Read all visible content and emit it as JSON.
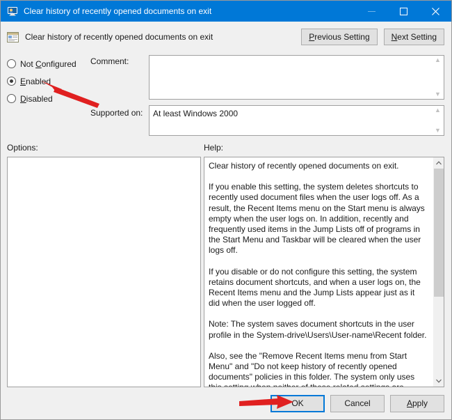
{
  "window": {
    "title": "Clear history of recently opened documents on exit",
    "icon": "policy-setting-monitor-icon",
    "accent_color": "#0078d7",
    "controls": {
      "minimize": "—",
      "maximize": "☐",
      "close": "✕"
    }
  },
  "header": {
    "icon": "policy-setting-window-icon",
    "title": "Clear history of recently opened documents on exit",
    "previous_setting": "Previous Setting",
    "previous_setting_accel": "P",
    "next_setting": "Next Setting",
    "next_setting_accel": "N"
  },
  "state_options": {
    "items": [
      {
        "label": "Not Configured",
        "accel": "C",
        "pre": "Not ",
        "post": "onfigured",
        "selected": false
      },
      {
        "label": "Enabled",
        "accel": "E",
        "pre": "",
        "post": "nabled",
        "selected": true
      },
      {
        "label": "Disabled",
        "accel": "D",
        "pre": "",
        "post": "isabled",
        "selected": false
      }
    ]
  },
  "fields": {
    "comment_label": "Comment:",
    "comment_value": "",
    "supported_label": "Supported on:",
    "supported_value": "At least Windows 2000"
  },
  "sections": {
    "options_label": "Options:",
    "help_label": "Help:"
  },
  "options_panel": {
    "content": ""
  },
  "help_panel": {
    "paragraphs": [
      "Clear history of recently opened documents on exit.",
      "If you enable this setting, the system deletes shortcuts to recently used document files when the user logs off. As a result, the Recent Items menu on the Start menu is always empty when the user logs on. In addition, recently and frequently used items in the Jump Lists off of programs in the Start Menu and Taskbar will be cleared when the user logs off.",
      "If you disable or do not configure this setting, the system retains document shortcuts, and when a user logs on, the Recent Items menu and the Jump Lists appear just as it did when the user logged off.",
      "Note: The system saves document shortcuts in the user profile in the System-drive\\Users\\User-name\\Recent folder.",
      "Also, see the \"Remove Recent Items menu from Start Menu\" and \"Do not keep history of recently opened documents\" policies in this folder. The system only uses this setting when neither of these related settings are selected."
    ],
    "scroll_up": "∧",
    "scroll_down": "∨"
  },
  "footer": {
    "ok": "OK",
    "cancel": "Cancel",
    "apply": "Apply",
    "apply_accel": "A"
  },
  "annotations": {
    "color": "#e02020",
    "arrow_enabled": "arrow-pointing-to-enabled-radio",
    "arrow_ok": "arrow-pointing-to-ok-button"
  }
}
